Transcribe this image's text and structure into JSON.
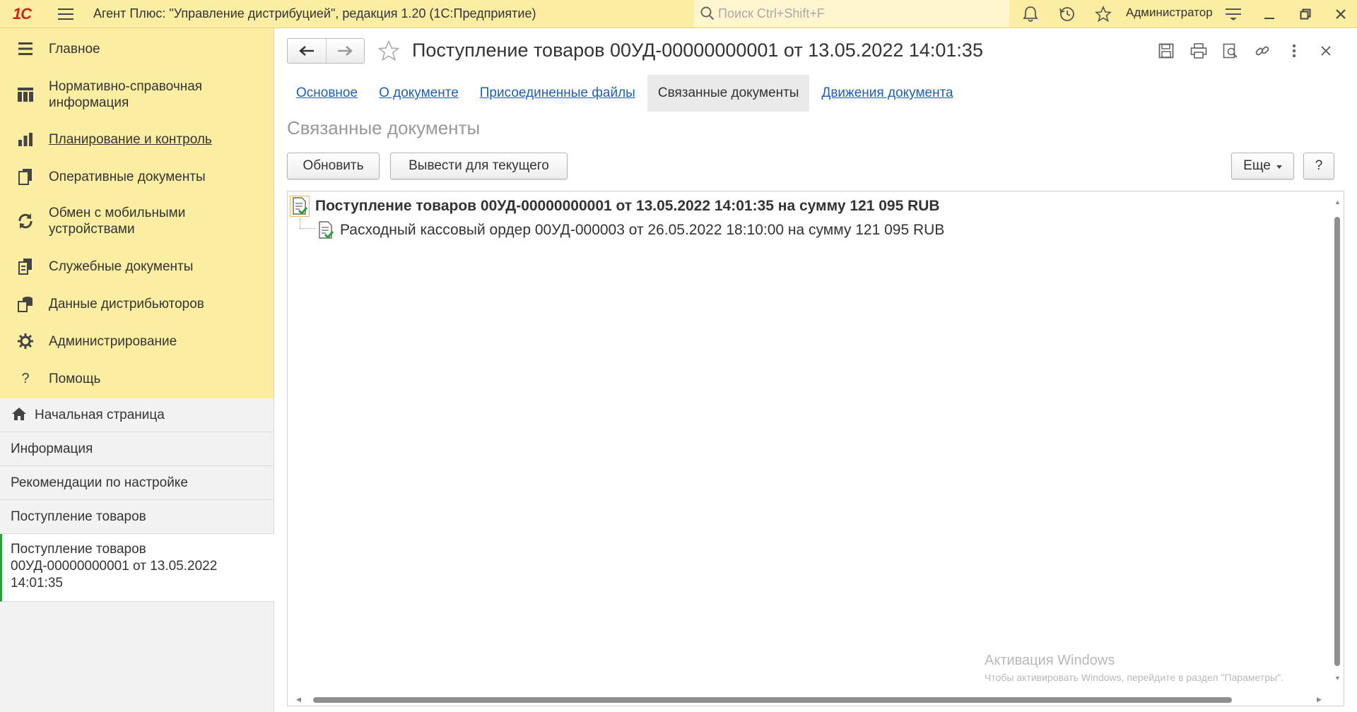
{
  "topbar": {
    "logo": "1С",
    "app_title": "Агент Плюс: \"Управление дистрибуцией\", редакция 1.20  (1С:Предприятие)",
    "search_placeholder": "Поиск Ctrl+Shift+F",
    "user": "Администратор",
    "icons": [
      "menu-icon",
      "search-icon",
      "bell-icon",
      "history-icon",
      "star-icon",
      "settings-lines-icon",
      "minimize-icon",
      "restore-icon",
      "close-icon"
    ]
  },
  "sidebar": {
    "items": [
      {
        "label": "Главное",
        "icon": "list-icon"
      },
      {
        "label": "Нормативно-справочная информация",
        "icon": "table-icon"
      },
      {
        "label": "Планирование и контроль",
        "icon": "bar-chart-icon"
      },
      {
        "label": "Оперативные документы",
        "icon": "documents-icon"
      },
      {
        "label": "Обмен с мобильными устройствами",
        "icon": "sync-icon"
      },
      {
        "label": "Служебные документы",
        "icon": "service-docs-icon"
      },
      {
        "label": "Данные дистрибьюторов",
        "icon": "distributor-icon"
      },
      {
        "label": "Администрирование",
        "icon": "gear-icon"
      },
      {
        "label": "Помощь",
        "icon": "help-icon"
      }
    ]
  },
  "open_windows": {
    "items": [
      {
        "label": "Начальная страница",
        "icon": "home-icon"
      },
      {
        "label": "Информация"
      },
      {
        "label": "Рекомендации по настройке"
      },
      {
        "label": "Поступление товаров"
      },
      {
        "label": "Поступление товаров 00УД-00000000001 от 13.05.2022 14:01:35"
      }
    ]
  },
  "document": {
    "title": "Поступление товаров 00УД-00000000001 от 13.05.2022 14:01:35",
    "tabs": [
      "Основное",
      "О документе",
      "Присоединенные файлы",
      "Связанные документы",
      "Движения документа"
    ],
    "active_tab": "Связанные документы",
    "section_title": "Связанные документы",
    "buttons": {
      "refresh": "Обновить",
      "show_current": "Вывести для текущего",
      "more": "Еще",
      "help": "?"
    },
    "tree": [
      {
        "text": "Поступление товаров 00УД-00000000001 от 13.05.2022 14:01:35 на сумму 121 095 RUB",
        "level": 0,
        "bold": true
      },
      {
        "text": "Расходный кассовый ордер 00УД-000003 от 26.05.2022 18:10:00 на сумму 121 095 RUB",
        "level": 1,
        "bold": false
      }
    ]
  },
  "watermark": {
    "line1": "Активация Windows",
    "line2": "Чтобы активировать Windows, перейдите в раздел \"Параметры\"."
  },
  "colors": {
    "sidebar_bg": "#fbeda2",
    "link": "#1f5fb4",
    "logo_red": "#d6201c",
    "active_marker": "#2c9a3e"
  }
}
